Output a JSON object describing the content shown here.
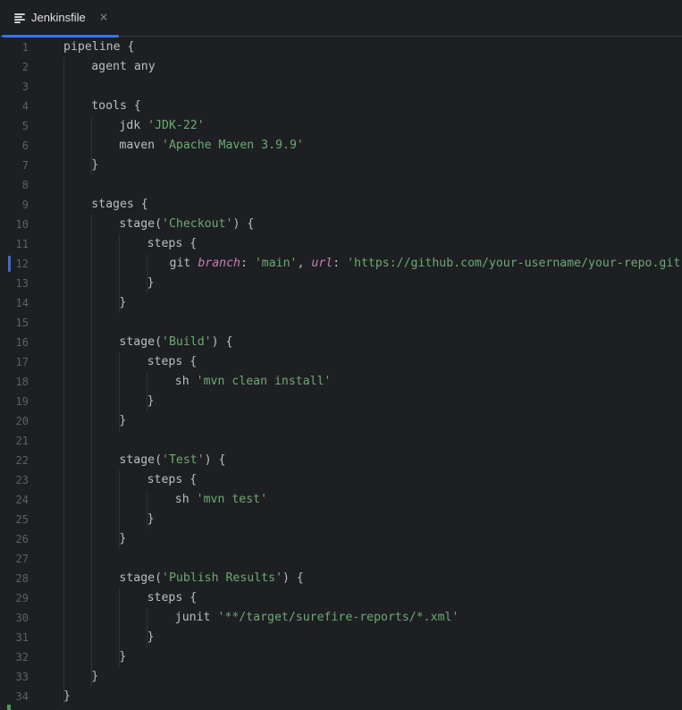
{
  "tab": {
    "title": "Jenkinsfile",
    "close_glyph": "×",
    "icon": "text-file-icon"
  },
  "lines": [
    {
      "n": "1",
      "indent": 0,
      "parts": [
        {
          "t": "pipeline {",
          "c": "plain"
        }
      ]
    },
    {
      "n": "2",
      "indent": 1,
      "parts": [
        {
          "t": "agent any",
          "c": "plain"
        }
      ]
    },
    {
      "n": "3",
      "indent": 0,
      "parts": []
    },
    {
      "n": "4",
      "indent": 1,
      "parts": [
        {
          "t": "tools {",
          "c": "plain"
        }
      ]
    },
    {
      "n": "5",
      "indent": 2,
      "parts": [
        {
          "t": "jdk ",
          "c": "plain"
        },
        {
          "t": "'JDK-22'",
          "c": "str"
        }
      ]
    },
    {
      "n": "6",
      "indent": 2,
      "parts": [
        {
          "t": "maven ",
          "c": "plain"
        },
        {
          "t": "'Apache Maven 3.9.9'",
          "c": "str"
        }
      ]
    },
    {
      "n": "7",
      "indent": 1,
      "parts": [
        {
          "t": "}",
          "c": "plain"
        }
      ]
    },
    {
      "n": "8",
      "indent": 0,
      "parts": []
    },
    {
      "n": "9",
      "indent": 1,
      "parts": [
        {
          "t": "stages {",
          "c": "plain"
        }
      ]
    },
    {
      "n": "10",
      "indent": 2,
      "parts": [
        {
          "t": "stage(",
          "c": "plain"
        },
        {
          "t": "'Checkout'",
          "c": "str"
        },
        {
          "t": ") {",
          "c": "plain"
        }
      ]
    },
    {
      "n": "11",
      "indent": 3,
      "parts": [
        {
          "t": "steps {",
          "c": "plain"
        }
      ]
    },
    {
      "n": "12",
      "indent": 3.8,
      "parts": [
        {
          "t": "git ",
          "c": "plain"
        },
        {
          "t": "branch",
          "c": "kw-param"
        },
        {
          "t": ": ",
          "c": "plain"
        },
        {
          "t": "'main'",
          "c": "str"
        },
        {
          "t": ", ",
          "c": "plain"
        },
        {
          "t": "url",
          "c": "kw-param"
        },
        {
          "t": ": ",
          "c": "plain"
        },
        {
          "t": "'https://github.com/your-username/your-repo.git'",
          "c": "str"
        }
      ]
    },
    {
      "n": "13",
      "indent": 3,
      "parts": [
        {
          "t": "}",
          "c": "plain"
        }
      ]
    },
    {
      "n": "14",
      "indent": 2,
      "parts": [
        {
          "t": "}",
          "c": "plain"
        }
      ]
    },
    {
      "n": "15",
      "indent": 0,
      "parts": []
    },
    {
      "n": "16",
      "indent": 2,
      "parts": [
        {
          "t": "stage(",
          "c": "plain"
        },
        {
          "t": "'Build'",
          "c": "str"
        },
        {
          "t": ") {",
          "c": "plain"
        }
      ]
    },
    {
      "n": "17",
      "indent": 3,
      "parts": [
        {
          "t": "steps {",
          "c": "plain"
        }
      ]
    },
    {
      "n": "18",
      "indent": 4,
      "parts": [
        {
          "t": "sh ",
          "c": "plain"
        },
        {
          "t": "'mvn clean install'",
          "c": "str"
        }
      ]
    },
    {
      "n": "19",
      "indent": 3,
      "parts": [
        {
          "t": "}",
          "c": "plain"
        }
      ]
    },
    {
      "n": "20",
      "indent": 2,
      "parts": [
        {
          "t": "}",
          "c": "plain"
        }
      ]
    },
    {
      "n": "21",
      "indent": 0,
      "parts": []
    },
    {
      "n": "22",
      "indent": 2,
      "parts": [
        {
          "t": "stage(",
          "c": "plain"
        },
        {
          "t": "'Test'",
          "c": "str"
        },
        {
          "t": ") {",
          "c": "plain"
        }
      ]
    },
    {
      "n": "23",
      "indent": 3,
      "parts": [
        {
          "t": "steps {",
          "c": "plain"
        }
      ]
    },
    {
      "n": "24",
      "indent": 4,
      "parts": [
        {
          "t": "sh ",
          "c": "plain"
        },
        {
          "t": "'mvn test'",
          "c": "str"
        }
      ]
    },
    {
      "n": "25",
      "indent": 3,
      "parts": [
        {
          "t": "}",
          "c": "plain"
        }
      ]
    },
    {
      "n": "26",
      "indent": 2,
      "parts": [
        {
          "t": "}",
          "c": "plain"
        }
      ]
    },
    {
      "n": "27",
      "indent": 0,
      "parts": []
    },
    {
      "n": "28",
      "indent": 2,
      "parts": [
        {
          "t": "stage(",
          "c": "plain"
        },
        {
          "t": "'Publish Results'",
          "c": "str"
        },
        {
          "t": ") {",
          "c": "plain"
        }
      ]
    },
    {
      "n": "29",
      "indent": 3,
      "parts": [
        {
          "t": "steps {",
          "c": "plain"
        }
      ]
    },
    {
      "n": "30",
      "indent": 4,
      "parts": [
        {
          "t": "junit ",
          "c": "plain"
        },
        {
          "t": "'**/target/surefire-reports/*.xml'",
          "c": "str"
        }
      ]
    },
    {
      "n": "31",
      "indent": 3,
      "parts": [
        {
          "t": "}",
          "c": "plain"
        }
      ]
    },
    {
      "n": "32",
      "indent": 2,
      "parts": [
        {
          "t": "}",
          "c": "plain"
        }
      ]
    },
    {
      "n": "33",
      "indent": 1,
      "parts": [
        {
          "t": "}",
          "c": "plain"
        }
      ]
    },
    {
      "n": "34",
      "indent": 0,
      "parts": [
        {
          "t": "}",
          "c": "plain"
        }
      ]
    }
  ],
  "modified_line": "12",
  "colors": {
    "string": "#6aab73",
    "parameter": "#c77dbb",
    "text": "#bcbec4",
    "accent": "#3574f0"
  }
}
